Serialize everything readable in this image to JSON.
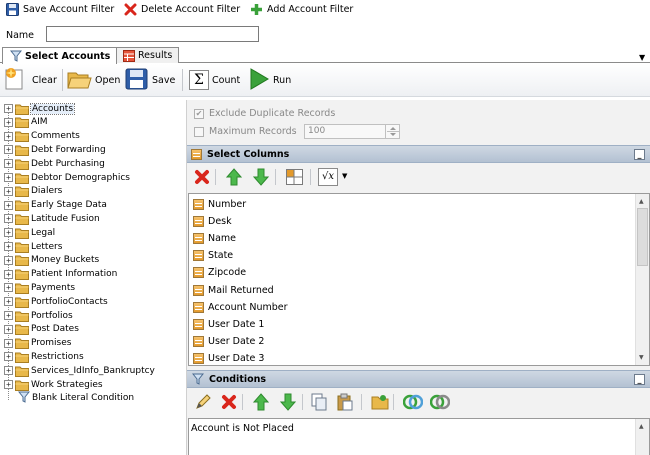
{
  "top_toolbar": {
    "save_label": "Save Account Filter",
    "delete_label": "Delete Account Filter",
    "add_label": "Add Account Filter"
  },
  "name_field": {
    "label": "Name",
    "value": ""
  },
  "tabs": [
    {
      "label": "Select Accounts",
      "active": true
    },
    {
      "label": "Results",
      "active": false
    }
  ],
  "main_toolbar": {
    "clear": "Clear",
    "open": "Open",
    "save": "Save",
    "count": "Count",
    "run": "Run"
  },
  "tree": {
    "items": [
      {
        "label": "Accounts",
        "selected": true
      },
      {
        "label": "AIM"
      },
      {
        "label": "Comments"
      },
      {
        "label": "Debt Forwarding"
      },
      {
        "label": "Debt Purchasing"
      },
      {
        "label": "Debtor Demographics"
      },
      {
        "label": "Dialers"
      },
      {
        "label": "Early Stage Data"
      },
      {
        "label": "Latitude Fusion"
      },
      {
        "label": "Legal"
      },
      {
        "label": "Letters"
      },
      {
        "label": "Money Buckets"
      },
      {
        "label": "Patient Information"
      },
      {
        "label": "Payments"
      },
      {
        "label": "PortfolioContacts"
      },
      {
        "label": "Portfolios"
      },
      {
        "label": "Post Dates"
      },
      {
        "label": "Promises"
      },
      {
        "label": "Restrictions"
      },
      {
        "label": "Services_IdInfo_Bankruptcy"
      },
      {
        "label": "Work Strategies"
      }
    ],
    "blank_condition": "Blank Literal Condition"
  },
  "options": {
    "exclude_duplicates": {
      "label": "Exclude Duplicate Records",
      "checked": true
    },
    "max_records": {
      "label": "Maximum Records",
      "checked": false,
      "value": "100"
    }
  },
  "select_columns": {
    "title": "Select Columns",
    "collapse": "_",
    "columns": [
      "Number",
      "Desk",
      "Name",
      "State",
      "Zipcode",
      "Mail Returned",
      "Account Number",
      "User Date 1",
      "User Date 2",
      "User Date 3"
    ]
  },
  "conditions": {
    "title": "Conditions",
    "collapse": "_",
    "items": [
      "Account is Not Placed"
    ]
  },
  "colors": {
    "section_header": "#b3c1d2",
    "folder": "#e8b84a",
    "delete_red": "#d9261c",
    "add_green": "#3aa13a"
  }
}
